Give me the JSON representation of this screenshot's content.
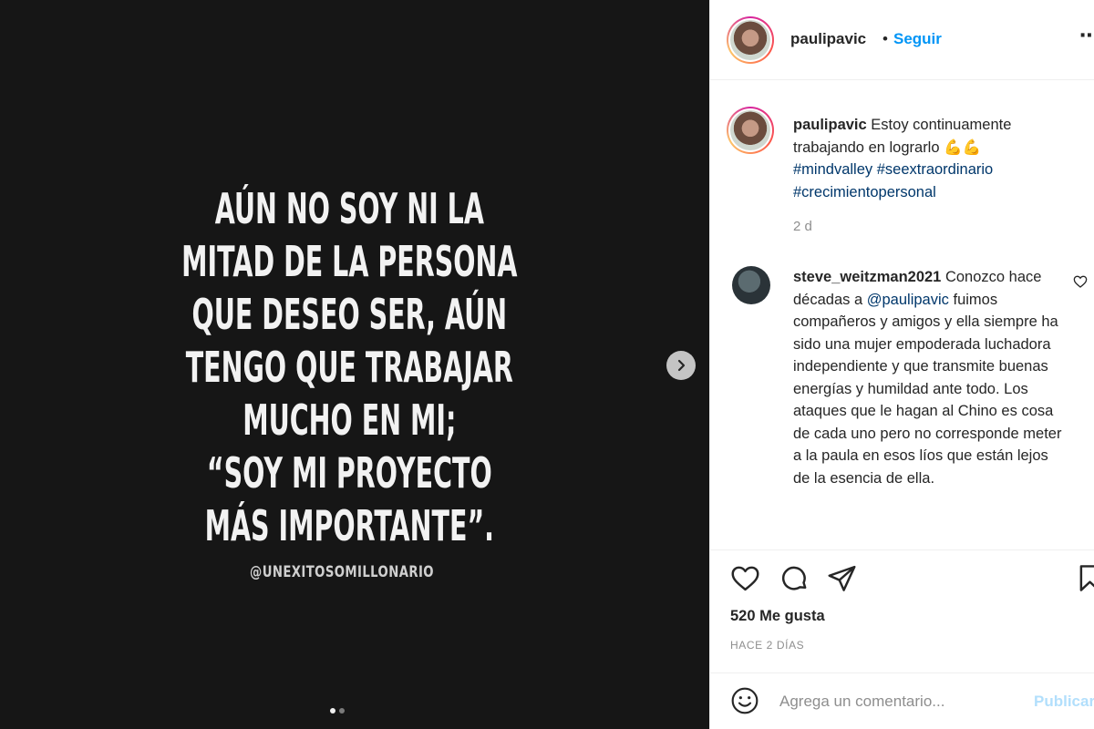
{
  "media": {
    "quote_lines": [
      "AÚN NO SOY NI LA",
      "MITAD DE LA PERSONA",
      "QUE DESEO SER, AÚN",
      "TENGO QUE TRABAJAR",
      "MUCHO EN MI;",
      "“SOY MI PROYECTO",
      "MÁS IMPORTANTE”."
    ],
    "watermark": "@UNEXITOSOMILLONARIO",
    "carousel_total": 2,
    "carousel_active": 1
  },
  "header": {
    "username": "paulipavic",
    "separator": "•",
    "follow_label": "Seguir",
    "more_label": "⋯"
  },
  "caption": {
    "username": "paulipavic",
    "text": "Estoy continuamente trabajando en lograrlo",
    "emoji": "💪💪",
    "hashtags": [
      "#mindvalley",
      "#seextraordinario",
      "#crecimientopersonal"
    ],
    "age": "2 d"
  },
  "comment": {
    "username": "steve_weitzman2021",
    "text_before": "Conozco hace décadas a",
    "mention": "@paulipavic",
    "text_after": "fuimos compañeros y amigos y ella siempre ha sido una mujer empoderada luchadora independiente y que transmite buenas energías y humildad ante todo. Los ataques que le hagan al Chino es cosa de cada uno pero no corresponde meter a la paula en esos líos que están lejos de la esencia de ella."
  },
  "stats": {
    "likes": "520 Me gusta",
    "time_ago": "HACE 2 DÍAS"
  },
  "add_comment": {
    "placeholder": "Agrega un comentario...",
    "publish_label": "Publicar"
  },
  "icons": {
    "next": "chevron-right-icon",
    "like": "heart-icon",
    "comment": "comment-bubble-icon",
    "share": "paper-plane-icon",
    "save": "bookmark-icon",
    "emoji": "smiley-icon"
  },
  "colors": {
    "accent": "#0095f6",
    "hashtag": "#00376b",
    "muted": "#8e8e8e",
    "publish_disabled": "#b2dffc",
    "media_bg": "#161616"
  }
}
